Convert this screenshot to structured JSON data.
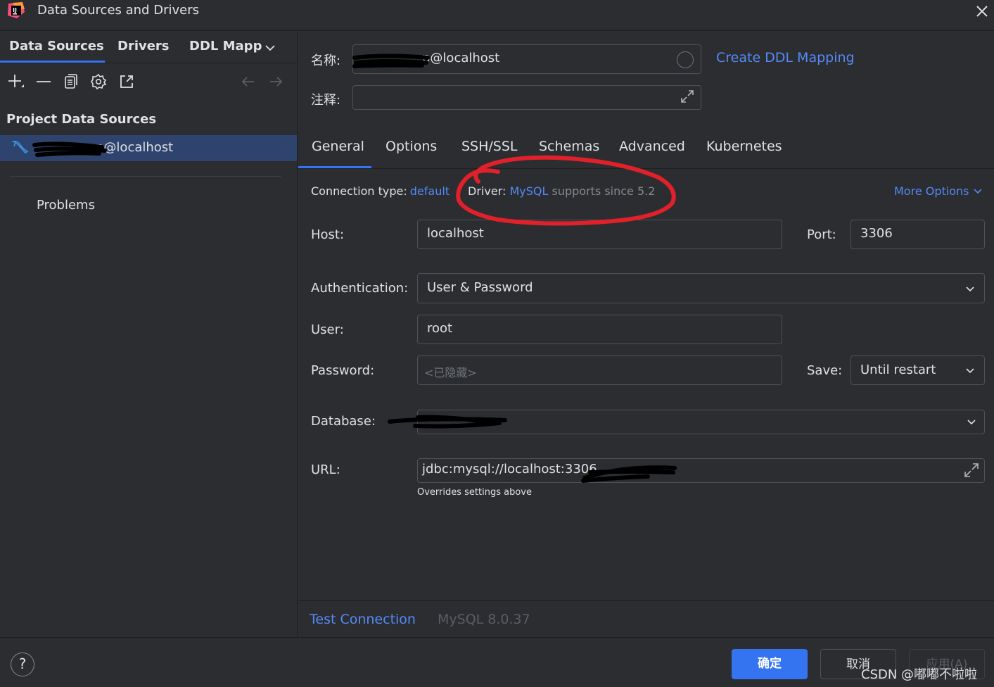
{
  "window": {
    "title": "Data Sources and Drivers",
    "logo_icon": "intellij-logo-icon",
    "close_icon": "close-icon"
  },
  "left": {
    "tabs": [
      {
        "label": "Data Sources",
        "selected": true
      },
      {
        "label": "Drivers",
        "selected": false
      },
      {
        "label": "DDL Mapp",
        "selected": false
      }
    ],
    "toolbar_icons": [
      "add-icon",
      "remove-icon",
      "duplicate-icon",
      "settings-icon",
      "go-to-icon",
      "back-icon",
      "forward-icon"
    ],
    "section_title": "Project Data Sources",
    "datasource": {
      "label": "p@localhost",
      "icon": "mysql-dolphin-icon"
    },
    "problems_label": "Problems"
  },
  "form": {
    "name_label": "名称:",
    "name_value": "p@localhost",
    "create_ddl_link": "Create DDL Mapping",
    "comment_label": "注释:",
    "comment_value": ""
  },
  "tabs": [
    {
      "label": "General",
      "selected": true
    },
    {
      "label": "Options",
      "selected": false
    },
    {
      "label": "SSH/SSL",
      "selected": false
    },
    {
      "label": "Schemas",
      "selected": false
    },
    {
      "label": "Advanced",
      "selected": false
    },
    {
      "label": "Kubernetes",
      "selected": false
    }
  ],
  "general": {
    "connection_type_label": "Connection type:",
    "connection_type_value": "default",
    "driver_label": "Driver:",
    "driver_value": "MySQL",
    "driver_note": "supports since 5.2",
    "more_options": "More Options",
    "host_label": "Host:",
    "host_value": "localhost",
    "port_label": "Port:",
    "port_value": "3306",
    "auth_label": "Authentication:",
    "auth_value": "User & Password",
    "user_label": "User:",
    "user_value": "root",
    "password_label": "Password:",
    "password_placeholder": "<已隐藏>",
    "save_label": "Save:",
    "save_value": "Until restart",
    "database_label": "Database:",
    "database_value": "",
    "url_label": "URL:",
    "url_value": "jdbc:mysql://localhost:3306",
    "url_hint": "Overrides settings above"
  },
  "bottom": {
    "test_connection": "Test Connection",
    "server_version": "MySQL 8.0.37",
    "help_label": "?",
    "ok_label": "确定",
    "cancel_label": "取消",
    "apply_label": "应用(A)",
    "watermark": "CSDN @嘟嘟不啦啦"
  },
  "colors": {
    "background": "#2b2d30",
    "selection": "#2e436e",
    "accent": "#3574f0",
    "link": "#548af7",
    "annotation_red": "#e0202a",
    "redaction_black": "#000000"
  }
}
